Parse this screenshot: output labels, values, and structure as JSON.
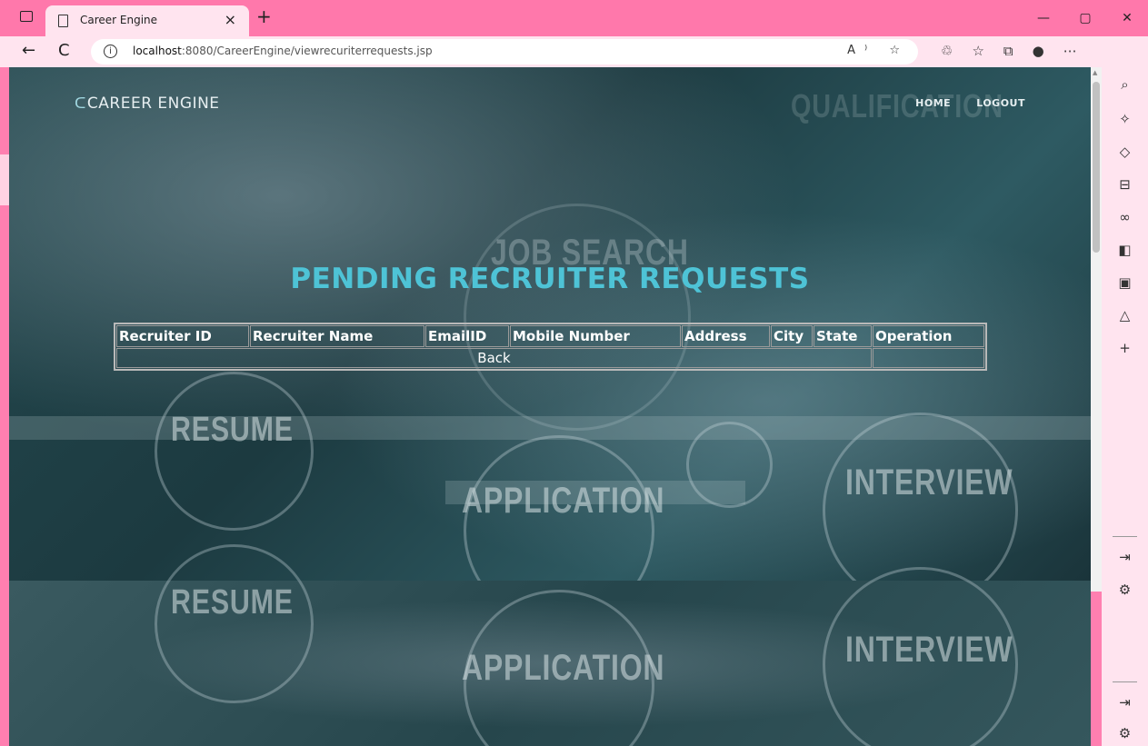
{
  "browser": {
    "tab_title": "Career Engine",
    "tab_close": "×",
    "new_tab": "+",
    "window_controls": [
      "—",
      "▢",
      "✕"
    ],
    "url_host": "localhost",
    "url_path": ":8080/CareerEngine/viewrecuriterrequests.jsp",
    "back_glyph": "←",
    "refresh_glyph": "C",
    "info_glyph": "i",
    "address_icons": [
      "A⁾",
      "☆"
    ],
    "toolbar_icons": [
      "♲",
      "☆",
      "⧉",
      "●",
      "⋯"
    ]
  },
  "site": {
    "brand": "CAREER ENGINE",
    "brand_logo": "ᑕ",
    "nav": {
      "home": "HOME",
      "logout": "LOGOUT"
    }
  },
  "page": {
    "heading": "PENDING RECRUITER REQUESTS",
    "table": {
      "columns": [
        "Recruiter ID",
        "Recruiter Name",
        "EmailID",
        "Mobile Number",
        "Address",
        "City",
        "State",
        "Operation"
      ],
      "back_label": "Back"
    }
  },
  "background_words": [
    "RESUME",
    "APPLICATION",
    "INTERVIEW",
    "JOB SEARCH",
    "QUALIFICATION",
    "RESUME",
    "APPLICATION",
    "INTERVIEW"
  ],
  "sidebar_icons": [
    "search-icon",
    "sparkle-icon",
    "tag-icon",
    "briefcase-icon",
    "people-icon",
    "office-icon",
    "outlook-icon",
    "bell-icon",
    "plus-icon",
    "panel-icon",
    "settings-icon",
    "panel-icon",
    "settings-icon"
  ],
  "colors": {
    "chrome_pink": "#ff78ab",
    "heading_cyan": "#4ec3d6",
    "hero_teal": "#24494f"
  }
}
